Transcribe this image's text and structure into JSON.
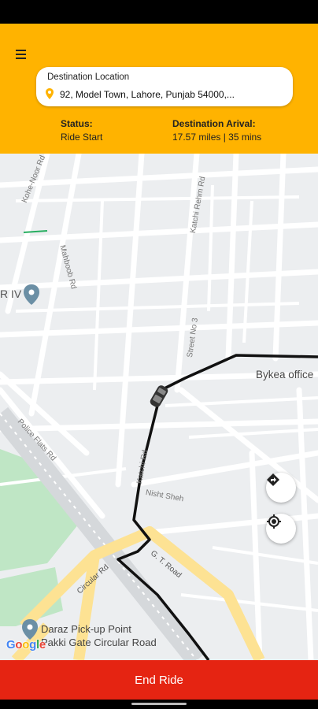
{
  "header": {
    "destination_label": "Destination Location",
    "destination_value": "92, Model Town, Lahore, Punjab 54000,...",
    "status_label": "Status:",
    "status_value": "Ride Start",
    "arrival_label": "Destination Arival:",
    "arrival_value": "17.57 miles | 35 mins"
  },
  "map": {
    "road_labels": [
      "Kohe-Noor Rd",
      "Katchi Rehm Rd",
      "Mahboob Rd",
      "Street No 3",
      "Police Flats Rd",
      "Nisht Sheh",
      "G. T. Road",
      "Circular Rd",
      "Katchi Rd"
    ],
    "place_labels": [
      "R IV",
      "Bykea office",
      "Daraz Pick-up Point",
      "Pakki Gate Circular Road"
    ],
    "logo": "Google"
  },
  "actions": {
    "end_ride_label": "End Ride"
  },
  "colors": {
    "header": "#ffb300",
    "end_ride": "#e52412",
    "route": "#111111",
    "major_road": "#fde293"
  },
  "icons": [
    "menu-icon",
    "location-pin-icon",
    "directions-icon",
    "my-location-icon",
    "car-icon",
    "map-pin-icon"
  ]
}
